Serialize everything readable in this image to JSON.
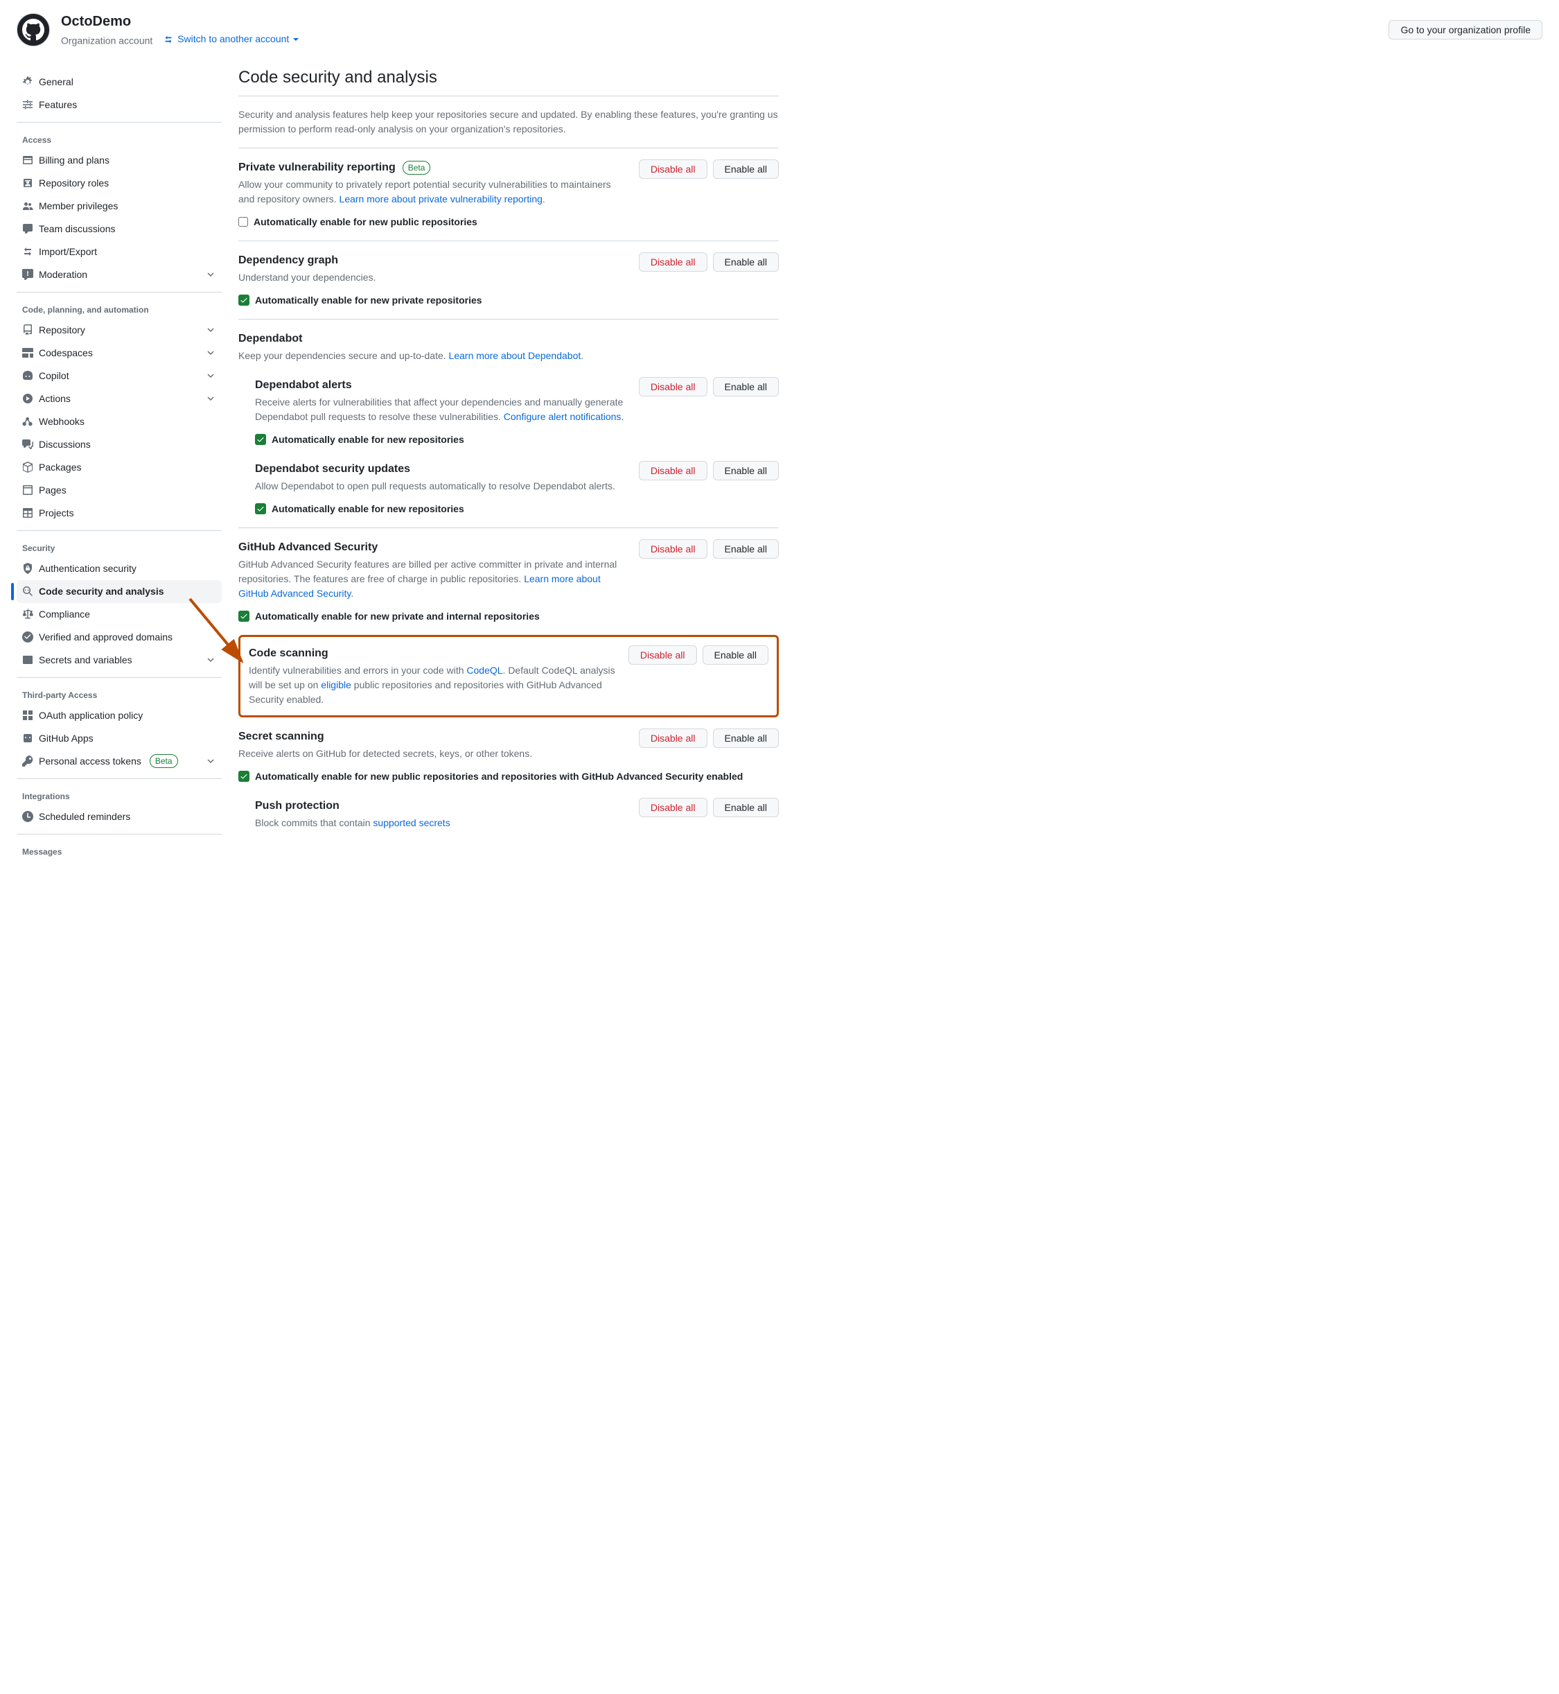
{
  "header": {
    "org_name": "OctoDemo",
    "org_type": "Organization account",
    "switch_label": "Switch to another account",
    "profile_button": "Go to your organization profile"
  },
  "sidebar": {
    "top_items": [
      {
        "icon": "gear",
        "label": "General"
      },
      {
        "icon": "sliders",
        "label": "Features"
      }
    ],
    "groups": [
      {
        "heading": "Access",
        "items": [
          {
            "icon": "credit-card",
            "label": "Billing and plans"
          },
          {
            "icon": "id-badge",
            "label": "Repository roles"
          },
          {
            "icon": "people",
            "label": "Member privileges"
          },
          {
            "icon": "comment",
            "label": "Team discussions"
          },
          {
            "icon": "swap",
            "label": "Import/Export"
          },
          {
            "icon": "report",
            "label": "Moderation",
            "chevron": true
          }
        ]
      },
      {
        "heading": "Code, planning, and automation",
        "items": [
          {
            "icon": "repo",
            "label": "Repository",
            "chevron": true
          },
          {
            "icon": "codespaces",
            "label": "Codespaces",
            "chevron": true
          },
          {
            "icon": "copilot",
            "label": "Copilot",
            "chevron": true
          },
          {
            "icon": "play",
            "label": "Actions",
            "chevron": true
          },
          {
            "icon": "webhook",
            "label": "Webhooks"
          },
          {
            "icon": "discussion",
            "label": "Discussions"
          },
          {
            "icon": "package",
            "label": "Packages"
          },
          {
            "icon": "browser",
            "label": "Pages"
          },
          {
            "icon": "table",
            "label": "Projects"
          }
        ]
      },
      {
        "heading": "Security",
        "items": [
          {
            "icon": "shield-lock",
            "label": "Authentication security"
          },
          {
            "icon": "codescan",
            "label": "Code security and analysis",
            "active": true
          },
          {
            "icon": "law",
            "label": "Compliance"
          },
          {
            "icon": "verified",
            "label": "Verified and approved domains"
          },
          {
            "icon": "key-asterisk",
            "label": "Secrets and variables",
            "chevron": true
          }
        ]
      },
      {
        "heading": "Third-party Access",
        "items": [
          {
            "icon": "apps",
            "label": "OAuth application policy"
          },
          {
            "icon": "hubot",
            "label": "GitHub Apps"
          },
          {
            "icon": "key",
            "label": "Personal access tokens",
            "badge": "Beta",
            "chevron": true
          }
        ]
      },
      {
        "heading": "Integrations",
        "items": [
          {
            "icon": "clock",
            "label": "Scheduled reminders"
          }
        ]
      },
      {
        "heading": "Messages",
        "items": []
      }
    ]
  },
  "main": {
    "title": "Code security and analysis",
    "intro": "Security and analysis features help keep your repositories secure and updated. By enabling these features, you're granting us permission to perform read-only analysis on your organization's repositories.",
    "disable_all": "Disable all",
    "enable_all": "Enable all",
    "sections": {
      "pvr": {
        "title": "Private vulnerability reporting",
        "badge": "Beta",
        "desc_pre": "Allow your community to privately report potential security vulnerabilities to maintainers and repository owners. ",
        "link": "Learn more about private vulnerability reporting",
        "checkbox": "Automatically enable for new public repositories",
        "checked": false
      },
      "depgraph": {
        "title": "Dependency graph",
        "desc": "Understand your dependencies.",
        "checkbox": "Automatically enable for new private repositories",
        "checked": true
      },
      "dependabot": {
        "title": "Dependabot",
        "desc_pre": "Keep your dependencies secure and up-to-date. ",
        "link": "Learn more about Dependabot",
        "alerts": {
          "title": "Dependabot alerts",
          "desc_pre": "Receive alerts for vulnerabilities that affect your dependencies and manually generate Dependabot pull requests to resolve these vulnerabilities. ",
          "link": "Configure alert notifications",
          "checkbox": "Automatically enable for new repositories",
          "checked": true
        },
        "updates": {
          "title": "Dependabot security updates",
          "desc": "Allow Dependabot to open pull requests automatically to resolve Dependabot alerts.",
          "checkbox": "Automatically enable for new repositories",
          "checked": true
        }
      },
      "ghas": {
        "title": "GitHub Advanced Security",
        "desc_pre": "GitHub Advanced Security features are billed per active committer in private and internal repositories. The features are free of charge in public repositories. ",
        "link": "Learn more about GitHub Advanced Security",
        "checkbox": "Automatically enable for new private and internal repositories",
        "checked": true
      },
      "codescan": {
        "title": "Code scanning",
        "desc_pre": "Identify vulnerabilities and errors in your code with ",
        "link1": "CodeQL",
        "desc_mid": ". Default CodeQL analysis will be set up on ",
        "link2": "eligible",
        "desc_post": " public repositories and repositories with GitHub Advanced Security enabled."
      },
      "secretscan": {
        "title": "Secret scanning",
        "desc": "Receive alerts on GitHub for detected secrets, keys, or other tokens.",
        "checkbox": "Automatically enable for new public repositories and repositories with GitHub Advanced Security enabled",
        "checked": true,
        "push": {
          "title": "Push protection",
          "desc_pre": "Block commits that contain ",
          "link": "supported secrets"
        }
      }
    }
  }
}
